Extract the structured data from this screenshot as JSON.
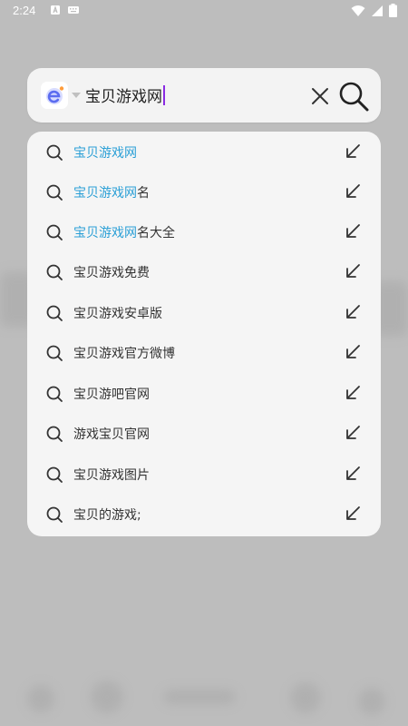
{
  "status_bar": {
    "time": "2:24",
    "icons": [
      "a-notification-icon",
      "keyboard-notification-icon",
      "wifi-icon",
      "signal-icon",
      "battery-icon"
    ]
  },
  "search": {
    "value": "宝贝游戏网",
    "placeholder": "",
    "engine_logo": "e-browser-logo",
    "clear_icon": "close-icon",
    "submit_icon": "search-icon"
  },
  "colors": {
    "highlight": "#2a9fd6",
    "caret": "#8a2be2",
    "card_bg": "#f3f3f3",
    "overlay_bg": "#bdbdbd"
  },
  "suggestions": [
    {
      "match": "宝贝游戏网",
      "rest": ""
    },
    {
      "match": "宝贝游戏网",
      "rest": "名"
    },
    {
      "match": "宝贝游戏网",
      "rest": "名大全"
    },
    {
      "match": "",
      "rest": "宝贝游戏免费"
    },
    {
      "match": "",
      "rest": "宝贝游戏安卓版"
    },
    {
      "match": "",
      "rest": "宝贝游戏官方微博"
    },
    {
      "match": "",
      "rest": "宝贝游吧官网"
    },
    {
      "match": "",
      "rest": "游戏宝贝官网"
    },
    {
      "match": "",
      "rest": "宝贝游戏图片"
    },
    {
      "match": "",
      "rest": "宝贝的游戏;"
    }
  ]
}
